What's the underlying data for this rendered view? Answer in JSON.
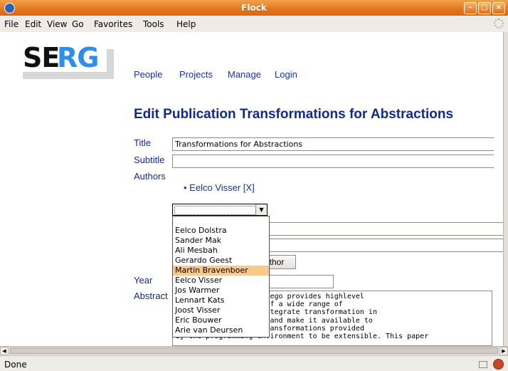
{
  "window": {
    "title": "Flock"
  },
  "menu": [
    "File",
    "Edit",
    "View",
    "Go",
    "Favorites",
    "Tools",
    "Help"
  ],
  "logo": {
    "part1": "SE",
    "part2": "RG"
  },
  "nav": [
    "People",
    "Projects",
    "Manage",
    "Login"
  ],
  "page": {
    "heading": "Edit Publication Transformations for Abstractions"
  },
  "form": {
    "title_label": "Title",
    "title_value": "Transformations for Abstractions",
    "subtitle_label": "Subtitle",
    "subtitle_value": "",
    "authors_label": "Authors",
    "authors": [
      "Eelco Visser [X]"
    ],
    "add_author_button": "uthor",
    "year_label": "Year",
    "year_value": "",
    "abstract_label": "Abstract",
    "abstract_lines": [
      "          nguage Stratego provides highlevel",
      "          ementation of a wide range of",
      "          aim is to integrate transformation in",
      "          ent process and make it available to",
      "          uires the transformations provided",
      "by the programming environment to be extensible. This paper"
    ]
  },
  "author_dropdown": {
    "selected": "",
    "options": [
      "",
      "Eelco Dolstra",
      "Sander Mak",
      "Ali Mesbah",
      "Gerardo Geest",
      "Martin Bravenboer",
      "Eelco Visser",
      "Jos Warmer",
      "Lennart Kats",
      "Joost Visser",
      "Eric Bouwer",
      "Arie van Deursen"
    ],
    "highlighted": "Martin Bravenboer"
  },
  "status": {
    "text": "Done"
  },
  "colors": {
    "titlebar": "#e2761e",
    "link": "#1a2fa8",
    "heading": "#122a8c",
    "highlight": "#f8c98a",
    "logo_accent": "#2f8ee8"
  }
}
